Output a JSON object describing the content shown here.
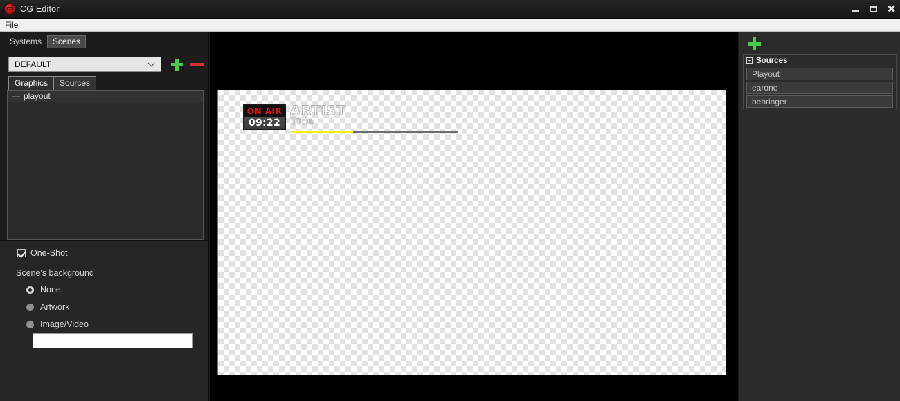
{
  "window": {
    "title": "CG Editor",
    "icon": "app-logo-icon",
    "controls": {
      "minimize": "minimize-icon",
      "maximize": "maximize-icon",
      "close": "close-icon"
    }
  },
  "menubar": {
    "items": [
      "File"
    ]
  },
  "left_panel": {
    "top_tabs": [
      {
        "label": "Systems",
        "active": false
      },
      {
        "label": "Scenes",
        "active": true
      }
    ],
    "scene_selector": {
      "value": "DEFAULT",
      "add_label": "+",
      "remove_label": "—"
    },
    "sub_tabs": [
      {
        "label": "Graphics",
        "active": true
      },
      {
        "label": "Sources",
        "active": false
      }
    ],
    "tree_items": [
      {
        "expander": "—",
        "label": "playout"
      }
    ],
    "options": {
      "one_shot": {
        "label": "One-Shot",
        "checked": true
      },
      "background_section_label": "Scene's background",
      "background_options": [
        {
          "label": "None",
          "selected": true
        },
        {
          "label": "Artwork",
          "selected": false
        },
        {
          "label": "Image/Video",
          "selected": false
        }
      ],
      "background_path": {
        "value": "",
        "placeholder": ""
      }
    }
  },
  "preview": {
    "overlay": {
      "on_air_text": "ON AIR",
      "clock_text": "09:22",
      "artist_text": "ARTIST",
      "title_text": "Title",
      "progress_percent": 37,
      "colors": {
        "on_air": "#ee1111",
        "progress_fill": "#f2f20a",
        "progress_track": "#6e6e6e"
      }
    }
  },
  "right_panel": {
    "add_button_label": "+",
    "group": {
      "title": "Sources",
      "collapse_icon": "collapse-minus-icon",
      "items": [
        {
          "label": "Playout"
        },
        {
          "label": "earone"
        },
        {
          "label": "behringer"
        }
      ]
    }
  }
}
